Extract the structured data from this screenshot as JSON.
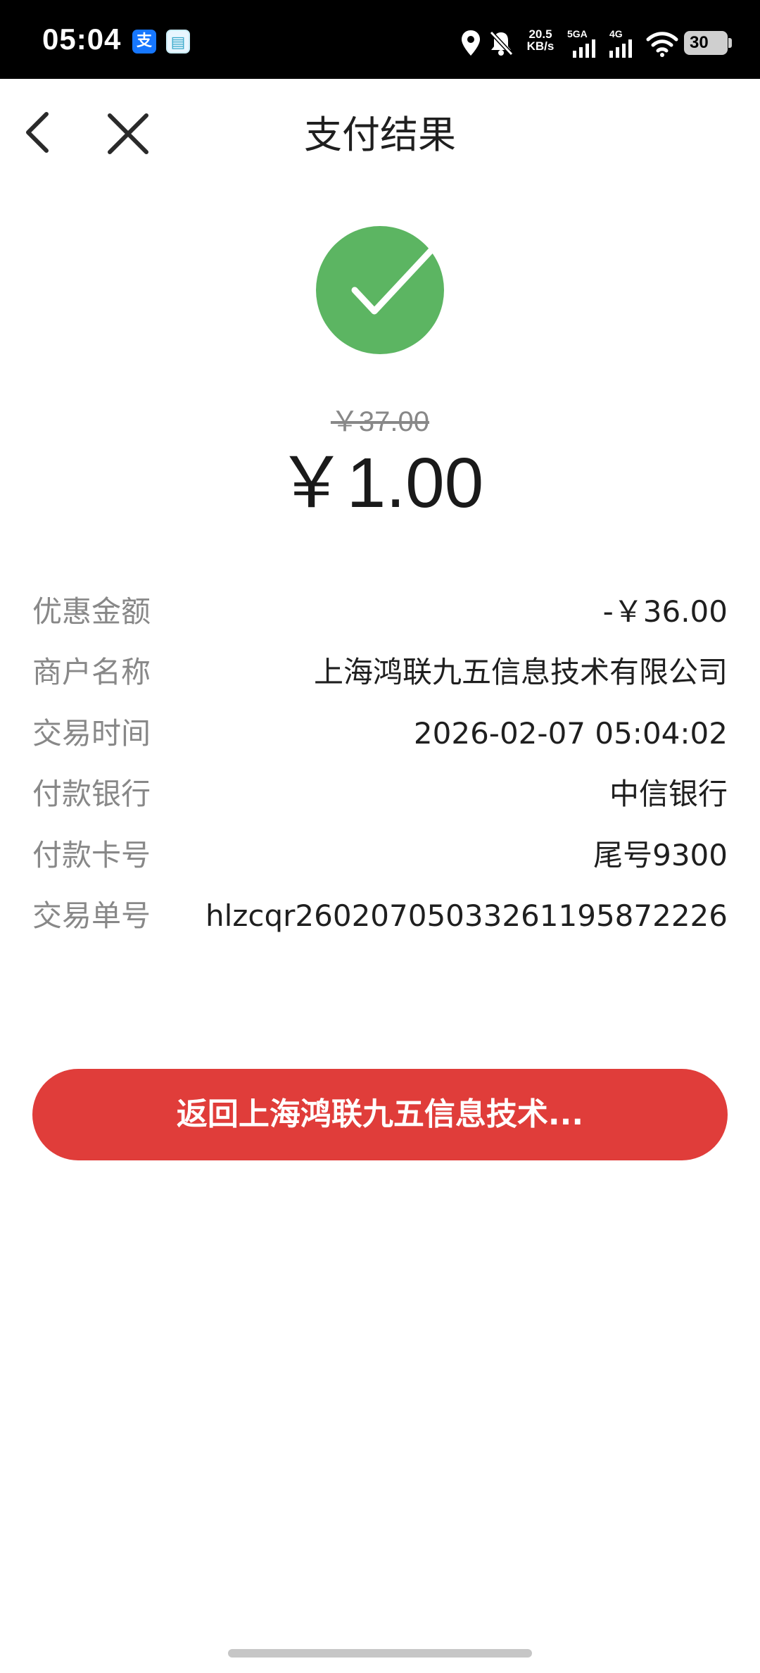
{
  "status_bar": {
    "time": "05:04",
    "alipay_badge": "支",
    "app_badge": "▤",
    "net_speed_value": "20.5",
    "net_speed_unit": "KB/s",
    "sim1_label": "5GA",
    "sim2_label": "4G",
    "battery": "30"
  },
  "header": {
    "title": "支付结果"
  },
  "payment": {
    "original_amount": "￥37.00",
    "paid_amount": "￥1.00"
  },
  "details": [
    {
      "label": "优惠金额",
      "value": "-￥36.00"
    },
    {
      "label": "商户名称",
      "value": "上海鸿联九五信息技术有限公司"
    },
    {
      "label": "交易时间",
      "value": "2026-02-07 05:04:02"
    },
    {
      "label": "付款银行",
      "value": "中信银行"
    },
    {
      "label": "付款卡号",
      "value": "尾号9300"
    },
    {
      "label": "交易单号",
      "value": "hlzcqr26020705033261195872226"
    }
  ],
  "actions": {
    "return_label": "返回上海鸿联九五信息技术..."
  },
  "colors": {
    "success_green": "#5cb562",
    "button_red": "#e03d3a",
    "label_gray": "#888888"
  },
  "icons": {
    "back": "chevron-left-icon",
    "close": "close-icon",
    "success": "check-circle-icon"
  }
}
